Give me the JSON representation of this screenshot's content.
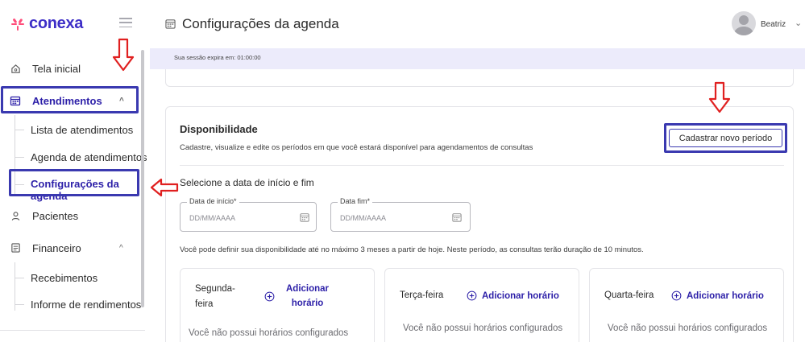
{
  "app": {
    "logo_text": "conexa"
  },
  "header": {
    "title": "Configurações da agenda",
    "user_name": "Beatriz"
  },
  "session": {
    "text": "Sua sessão expira em: 01:00:00"
  },
  "sidebar": {
    "items": [
      {
        "label": "Tela inicial"
      },
      {
        "label": "Atendimentos"
      },
      {
        "label": "Pacientes"
      },
      {
        "label": "Financeiro"
      }
    ],
    "atendimentos_sub": [
      {
        "label": "Lista de atendimentos"
      },
      {
        "label": "Agenda de atendimentos"
      },
      {
        "label": "Configurações da agenda"
      }
    ],
    "financeiro_sub": [
      {
        "label": "Recebimentos"
      },
      {
        "label": "Informe de rendimentos"
      }
    ]
  },
  "availability": {
    "title": "Disponibilidade",
    "description": "Cadastre, visualize e edite os períodos em que você estará disponível para agendamentos de consultas",
    "new_period_button": "Cadastrar novo período",
    "select_label": "Selecione a data de início e fim",
    "start_date": {
      "label": "Data de início*",
      "placeholder": "DD/MM/AAAA"
    },
    "end_date": {
      "label": "Data fim*",
      "placeholder": "DD/MM/AAAA"
    },
    "helper": "Você pode definir sua disponibilidade até no máximo 3 meses a partir de hoje. Neste período, as consultas terão duração de 10 minutos.",
    "days": [
      {
        "name_line1": "Segunda-",
        "name_line2": "feira",
        "add_line1": "Adicionar",
        "add_line2": "horário",
        "empty": "Você não possui horários configurados"
      },
      {
        "name": "Terça-feira",
        "add": "Adicionar horário",
        "empty": "Você não possui horários configurados"
      },
      {
        "name": "Quarta-feira",
        "add": "Adicionar horário",
        "empty": "Você não possui horários configurados"
      }
    ]
  },
  "colors": {
    "brand": "#3d2ec7",
    "accent_pink": "#ff4d7a",
    "highlight_box": "#3a39b0",
    "annotation_arrow": "#e02020",
    "session_bar": "#ecebfb"
  }
}
